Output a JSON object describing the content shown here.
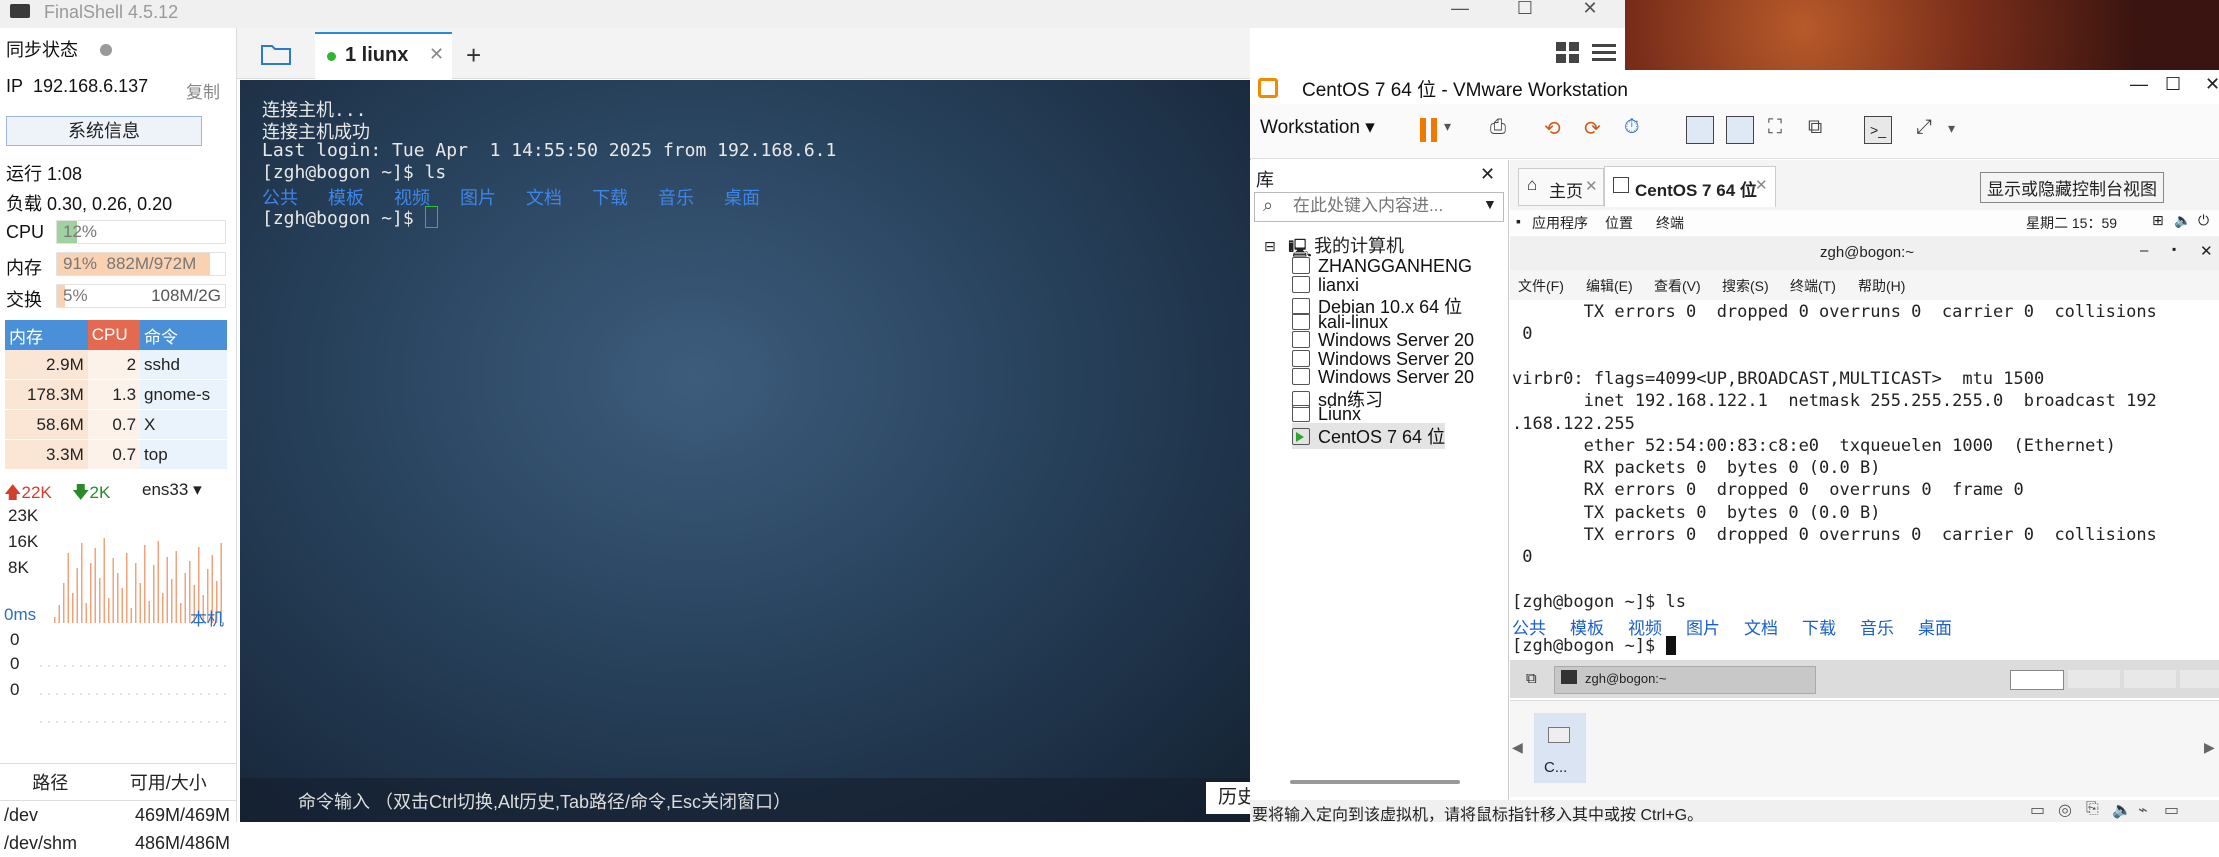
{
  "finalshell": {
    "title": "FinalShell 4.5.12",
    "sync_status": "同步状态",
    "ip_label": "IP",
    "ip": "192.168.6.137",
    "copy": "复制",
    "sysinfo_btn": "系统信息",
    "uptime": "运行 1:08",
    "load": "负载 0.30, 0.26, 0.20",
    "cpu_label": "CPU",
    "cpu_text": "12%",
    "cpu_fraction": 0.12,
    "mem_label": "内存",
    "mem_pct": "91%",
    "mem_val": "882M/972M",
    "mem_fraction": 0.91,
    "swap_label": "交换",
    "swap_pct": "5%",
    "swap_val": "108M/2G",
    "swap_fraction": 0.05,
    "proc_headers": [
      "内存",
      "CPU",
      "命令"
    ],
    "processes": [
      {
        "mem": "2.9M",
        "cpu": "2",
        "cmd": "sshd"
      },
      {
        "mem": "178.3M",
        "cpu": "1.3",
        "cmd": "gnome-s"
      },
      {
        "mem": "58.6M",
        "cpu": "0.7",
        "cmd": "X"
      },
      {
        "mem": "3.3M",
        "cpu": "0.7",
        "cmd": "top"
      }
    ],
    "net_up": "22K",
    "net_down": "2K",
    "net_iface": "ens33",
    "net_ticks": [
      "23K",
      "16K",
      "8K"
    ],
    "ping_ms": "0ms",
    "ping_host": "本机",
    "ping_values": [
      "0",
      "0",
      "0"
    ],
    "disk_headers": [
      "路径",
      "可用/大小"
    ],
    "disks": [
      {
        "path": "/dev",
        "size": "469M/469M"
      },
      {
        "path": "/dev/shm",
        "size": "486M/486M"
      }
    ],
    "tab_label": "1 liunx",
    "terminal_lines": [
      "连接主机...",
      "连接主机成功",
      "Last login: Tue Apr  1 14:55:50 2025 from 192.168.6.1",
      "[zgh@bogon ~]$ ls"
    ],
    "ls_dirs": [
      "公共",
      "模板",
      "视频",
      "图片",
      "文档",
      "下载",
      "音乐",
      "桌面"
    ],
    "prompt": "[zgh@bogon ~]$ ",
    "cmd_hint": "命令输入 （双击Ctrl切换,Alt历史,Tab路径/命令,Esc关闭窗口）",
    "history_btn": "历史"
  },
  "vmware": {
    "title": "CentOS 7 64 位 - VMware Workstation",
    "workstation_menu": "Workstation",
    "library_label": "库",
    "search_placeholder": "在此处键入内容进...",
    "my_computer": "我的计算机",
    "vms": [
      "ZHANGGANHENG",
      "lianxi",
      "Debian 10.x 64 位",
      "kali-linux",
      "Windows Server 20",
      "Windows Server 20",
      "Windows Server 20",
      "sdn练习",
      "Liunx",
      "CentOS 7 64 位"
    ],
    "tab_home": "主页",
    "tab_vm": "CentOS 7 64 位",
    "tooltip": "显示或隐藏控制台视图",
    "guest_apps": "应用程序",
    "guest_places": "位置",
    "guest_terminal": "终端",
    "guest_clock": "星期二 15：59",
    "gterm_title": "zgh@bogon:~",
    "gterm_menu": [
      "文件(F)",
      "编辑(E)",
      "查看(V)",
      "搜索(S)",
      "终端(T)",
      "帮助(H)"
    ],
    "gterm_lines": [
      "       TX errors 0  dropped 0 overruns 0  carrier 0  collisions",
      " 0",
      "",
      "virbr0: flags=4099<UP,BROADCAST,MULTICAST>  mtu 1500",
      "       inet 192.168.122.1  netmask 255.255.255.0  broadcast 192",
      ".168.122.255",
      "       ether 52:54:00:83:c8:e0  txqueuelen 1000  (Ethernet)",
      "       RX packets 0  bytes 0 (0.0 B)",
      "       RX errors 0  dropped 0  overruns 0  frame 0",
      "       TX packets 0  bytes 0 (0.0 B)",
      "       TX errors 0  dropped 0 overruns 0  carrier 0  collisions",
      " 0",
      "",
      "[zgh@bogon ~]$ ls"
    ],
    "gterm_dirs": [
      "公共",
      "模板",
      "视频",
      "图片",
      "文档",
      "下载",
      "音乐",
      "桌面"
    ],
    "gterm_prompt": "[zgh@bogon ~]$ ",
    "task_item": "zgh@bogon:~",
    "thumb_label": "C...",
    "status_text": "要将输入定向到该虚拟机，请将鼠标指针移入其中或按 Ctrl+G。"
  }
}
